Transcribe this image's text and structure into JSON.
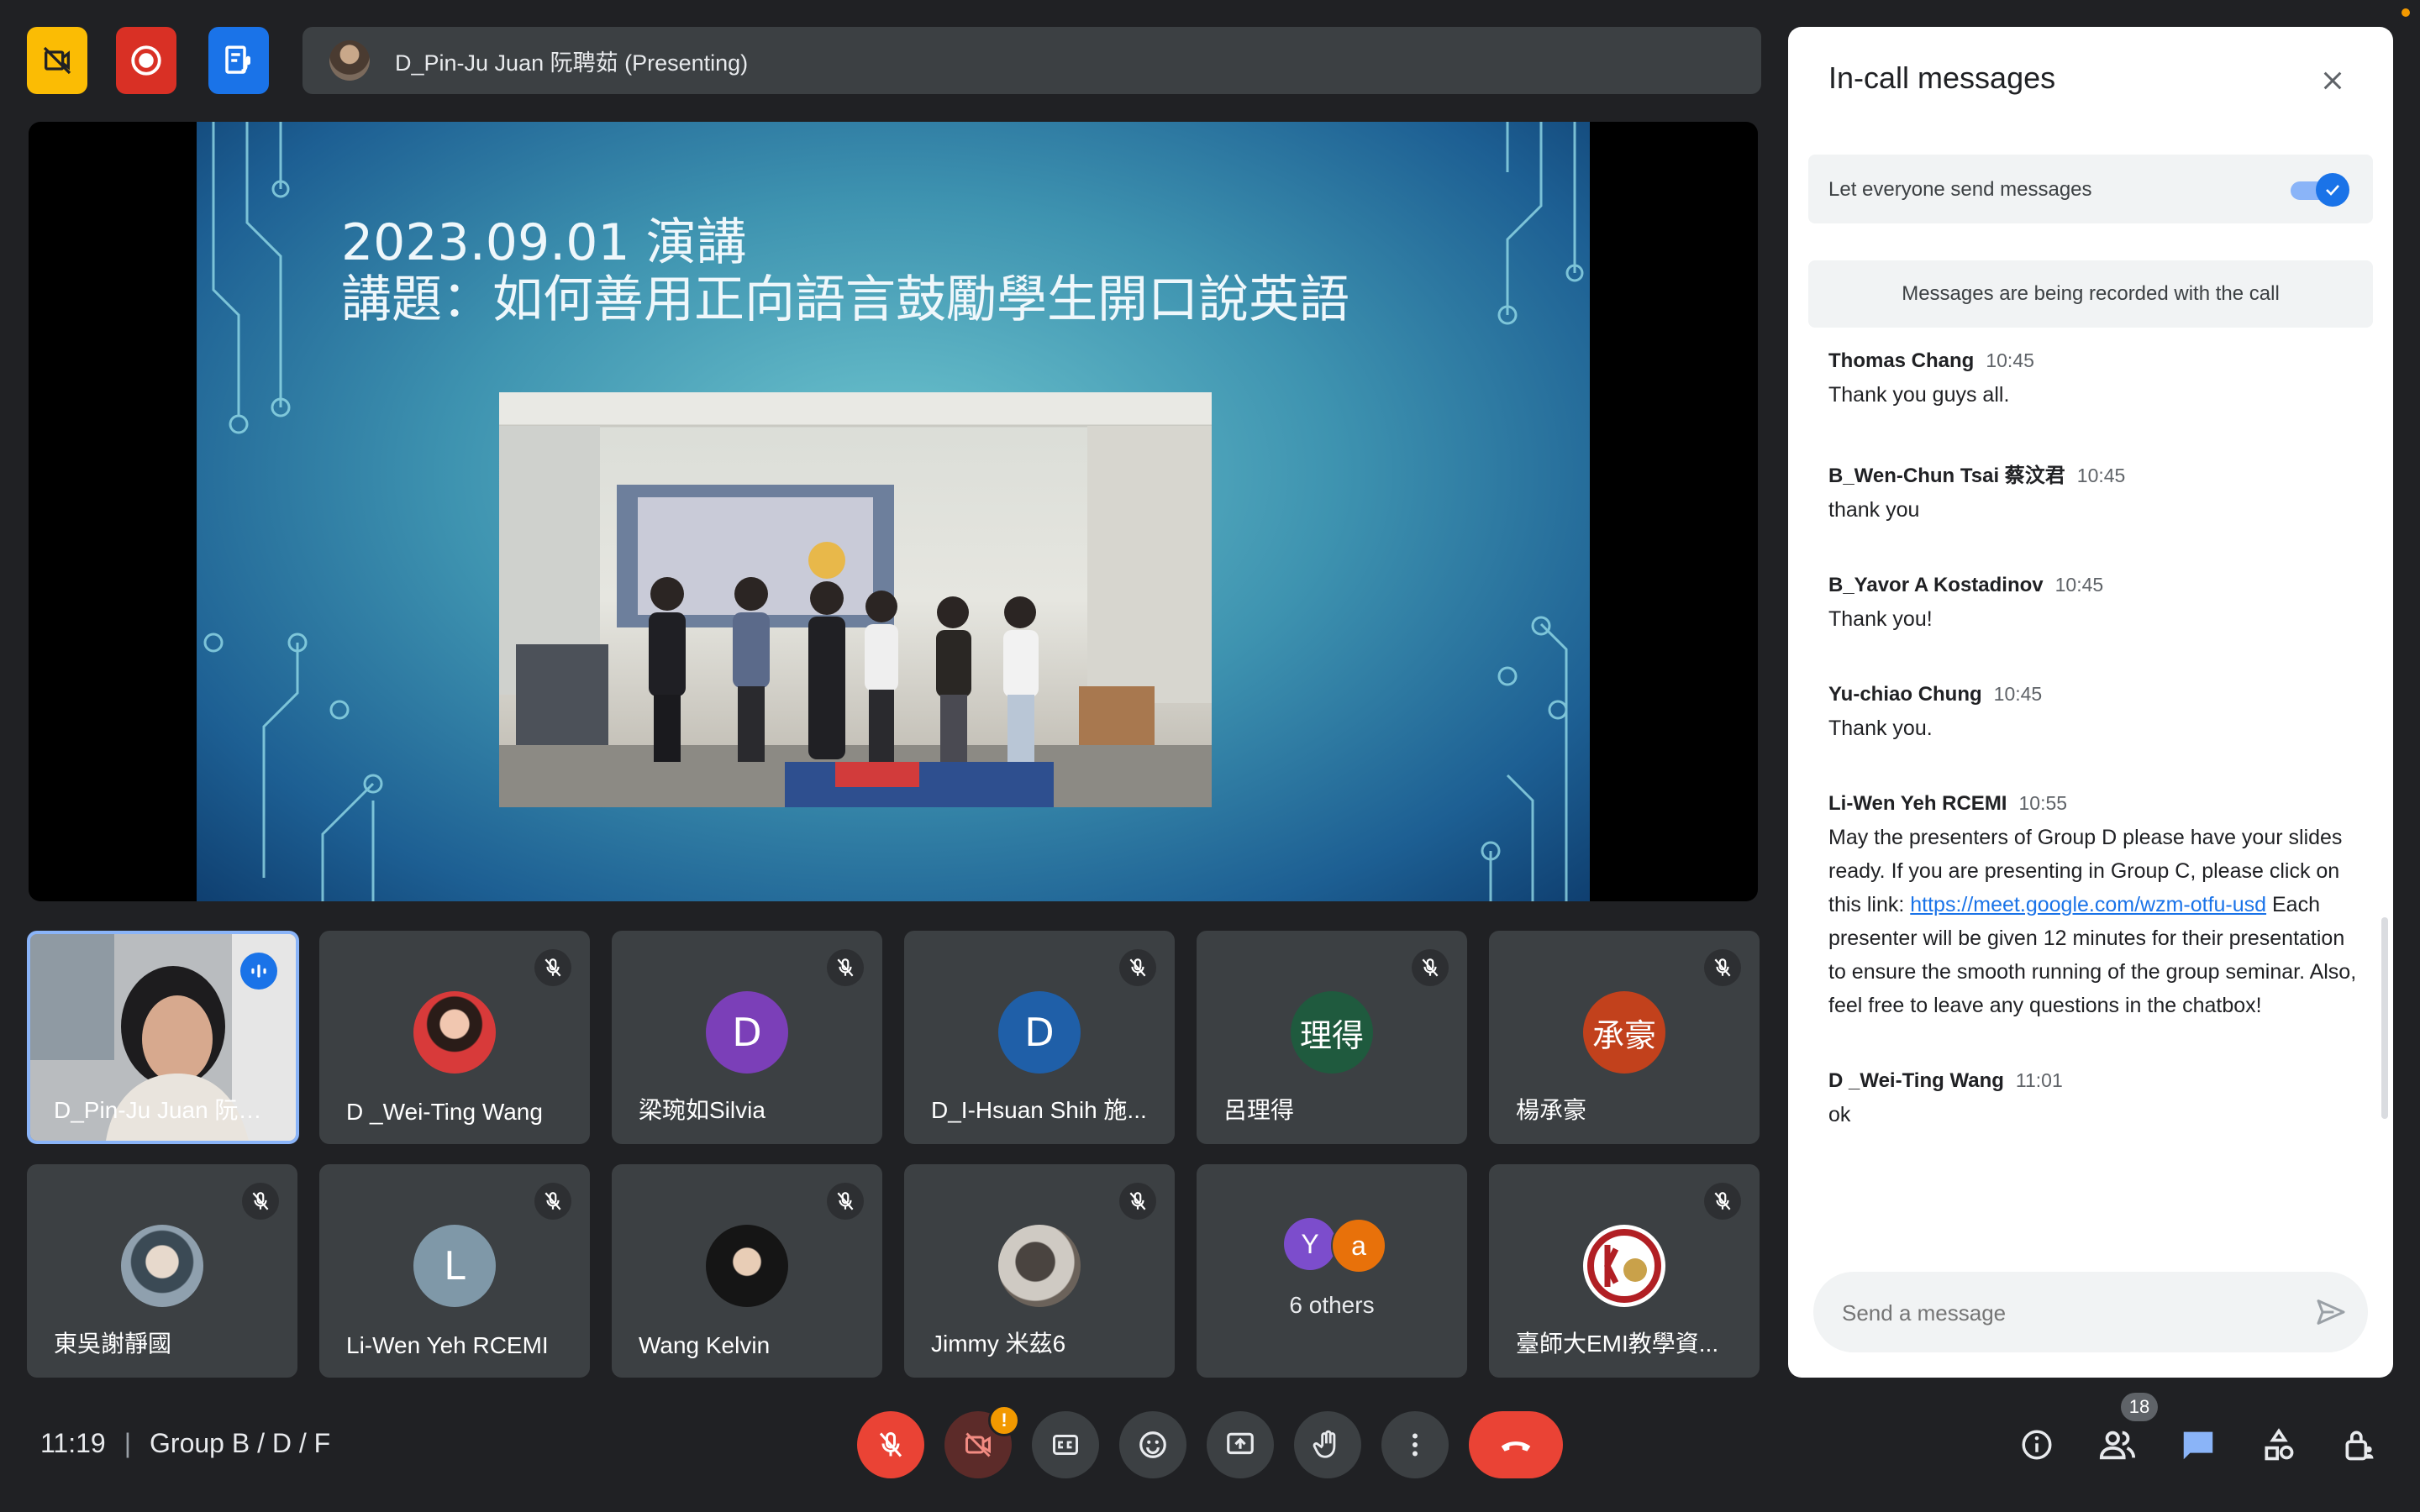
{
  "topbar": {
    "presenter_label": "D_Pin-Ju Juan 阮聘茹 (Presenting)"
  },
  "slide": {
    "title_line1": "2023.09.01 演講",
    "title_line2": "講題：如何善用正向語言鼓勵學生開口說英語"
  },
  "tiles": [
    {
      "name": "D_Pin-Ju Juan 阮聘茹",
      "avatar_letter": "",
      "avatar_color": ""
    },
    {
      "name": "D _Wei-Ting Wang",
      "avatar_letter": "",
      "avatar_color": ""
    },
    {
      "name": "梁琬如Silvia",
      "avatar_letter": "D",
      "avatar_color": "#7b3fb8"
    },
    {
      "name": "D_I-Hsuan Shih 施...",
      "avatar_letter": "D",
      "avatar_color": "#1f5fa8"
    },
    {
      "name": "呂理得",
      "avatar_letter": "理得",
      "avatar_color": "#1f5a3e"
    },
    {
      "name": "楊承豪",
      "avatar_letter": "承豪",
      "avatar_color": "#c2411c"
    },
    {
      "name": "東吳謝靜國",
      "avatar_letter": "",
      "avatar_color": ""
    },
    {
      "name": "Li-Wen Yeh RCEMI",
      "avatar_letter": "L",
      "avatar_color": "#7f98a8"
    },
    {
      "name": "Wang Kelvin",
      "avatar_letter": "",
      "avatar_color": ""
    },
    {
      "name": "Jimmy 米茲6",
      "avatar_letter": "",
      "avatar_color": ""
    },
    {
      "name": "6 others",
      "avatar_letter": "",
      "avatar_color": ""
    },
    {
      "name": "臺師大EMI教學資...",
      "avatar_letter": "",
      "avatar_color": ""
    }
  ],
  "others": {
    "a1": "Y",
    "a2": "a"
  },
  "panel": {
    "title": "In-call messages",
    "toggle_label": "Let everyone send messages",
    "toggle_on": true,
    "recorded_note": "Messages are being recorded with the call",
    "messages": [
      {
        "sender": "Thomas Chang",
        "time": "10:45",
        "text": "Thank you guys all."
      },
      {
        "sender": "B_Wen-Chun Tsai 蔡汶君",
        "time": "10:45",
        "text": "thank you"
      },
      {
        "sender": "B_Yavor A Kostadinov",
        "time": "10:45",
        "text": "Thank you!"
      },
      {
        "sender": "Yu-chiao Chung",
        "time": "10:45",
        "text": "Thank you."
      },
      {
        "sender": "Li-Wen Yeh RCEMI",
        "time": "10:55",
        "text_before": "May the presenters of Group D please have your slides ready. If you are presenting in Group C, please click on this link: ",
        "link": "https://meet.google.com/wzm-otfu-usd",
        "text_after": "  Each presenter will be given 12 minutes for their presentation to ensure the smooth running of the group seminar. Also, feel free to leave any questions in the chatbox!"
      },
      {
        "sender": "D _Wei-Ting Wang",
        "time": "11:01",
        "text": "ok"
      }
    ],
    "input_placeholder": "Send a message"
  },
  "bottom": {
    "time": "11:19",
    "divider": "|",
    "meeting_name": "Group B / D / F",
    "people_count": "18"
  },
  "colors": {
    "end_call": "#ea4335",
    "mic_off": "#ea4335",
    "accent": "#1a73e8",
    "yellow_btn": "#fbbc04",
    "record_btn": "#d93025",
    "blue_btn": "#1a73e8",
    "chat_active": "#8ab4f8"
  }
}
